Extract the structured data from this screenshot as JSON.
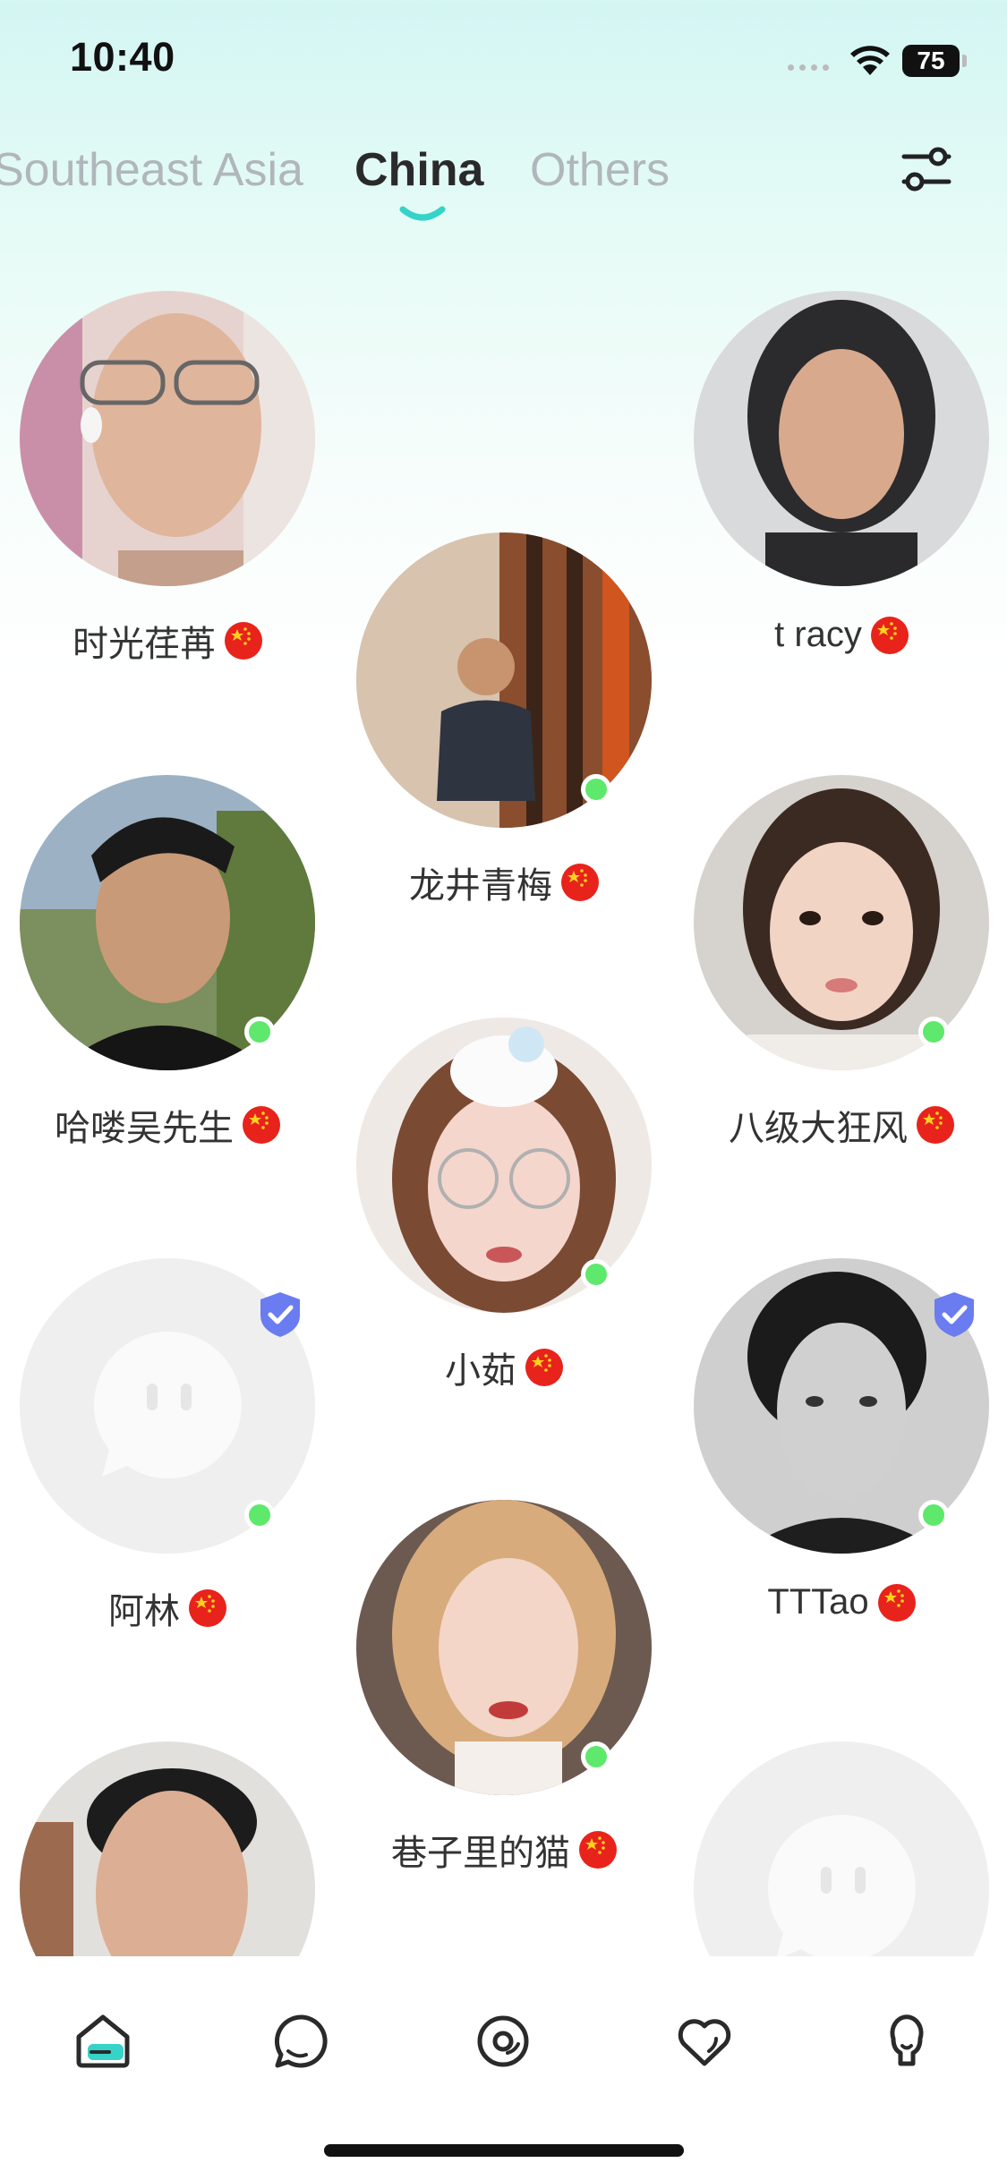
{
  "status_bar": {
    "time": "10:40",
    "battery": "75"
  },
  "tabs": [
    {
      "label": "Southeast Asia",
      "active": false
    },
    {
      "label": "China",
      "active": true
    },
    {
      "label": "Others",
      "active": false
    }
  ],
  "profiles": [
    {
      "name": "时光荏苒",
      "online": false,
      "verified": false,
      "avatar": "photo"
    },
    {
      "name": "t racy",
      "online": false,
      "verified": false,
      "avatar": "photo"
    },
    {
      "name": "龙井青梅",
      "online": true,
      "verified": false,
      "avatar": "photo"
    },
    {
      "name": "哈喽吴先生",
      "online": true,
      "verified": false,
      "avatar": "photo"
    },
    {
      "name": "八级大狂风",
      "online": true,
      "verified": false,
      "avatar": "photo"
    },
    {
      "name": "小茹",
      "online": true,
      "verified": false,
      "avatar": "photo"
    },
    {
      "name": "阿林",
      "online": true,
      "verified": true,
      "avatar": "default-chat-icon"
    },
    {
      "name": "TTTao",
      "online": true,
      "verified": true,
      "avatar": "photo"
    },
    {
      "name": "巷子里的猫",
      "online": true,
      "verified": false,
      "avatar": "photo"
    },
    {
      "name": "",
      "online": false,
      "verified": false,
      "avatar": "photo"
    },
    {
      "name": "",
      "online": false,
      "verified": false,
      "avatar": "default-chat-icon"
    }
  ],
  "bottom_nav": [
    {
      "icon": "home-icon",
      "active": true
    },
    {
      "icon": "chat-icon",
      "active": false
    },
    {
      "icon": "discover-icon",
      "active": false
    },
    {
      "icon": "heart-icon",
      "active": false
    },
    {
      "icon": "profile-icon",
      "active": false
    }
  ],
  "colors": {
    "accent": "#35d3c8",
    "online": "#5ee86c",
    "verified": "#6a7cf0",
    "flag": "#e8231b"
  }
}
